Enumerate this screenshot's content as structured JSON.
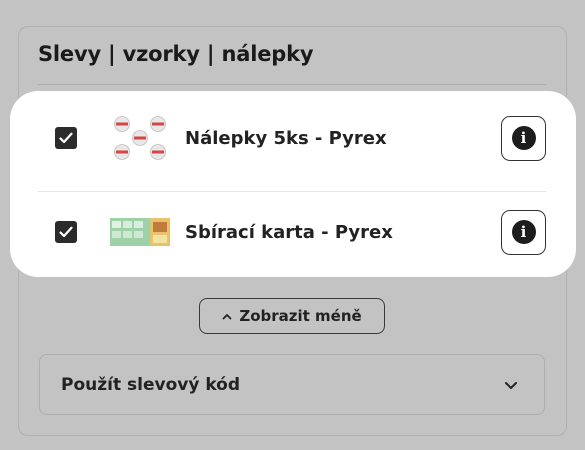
{
  "section": {
    "title": "Slevy | vzorky | nálepky"
  },
  "items": [
    {
      "label": "Nálepky 5ks - Pyrex",
      "checked": true,
      "thumb_icon": "stickers-thumbnail",
      "info_icon": "info-icon"
    },
    {
      "label": "Sbírací karta - Pyrex",
      "checked": true,
      "thumb_icon": "collectible-card-thumbnail",
      "info_icon": "info-icon"
    }
  ],
  "toggle": {
    "label": "Zobrazit méně",
    "icon": "chevron-up-icon"
  },
  "coupon": {
    "label": "Použít slevový kód",
    "icon": "chevron-down-icon"
  },
  "info_glyph": "i",
  "colors": {
    "background": "#c3c3c3",
    "card": "#ffffff",
    "checkbox": "#2b2b2b",
    "text": "#1f1f1f",
    "sticker_red": "#d64545",
    "card_green": "#7fbf8a"
  }
}
